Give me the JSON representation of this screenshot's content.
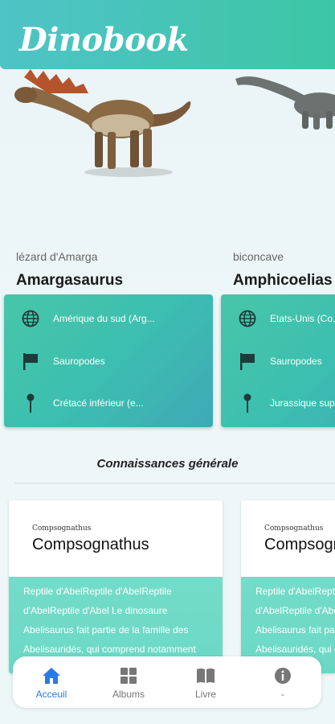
{
  "app": {
    "title": "Dinobook"
  },
  "dinosaurs": [
    {
      "subtitle": "lézard d'Amarga",
      "name": "Amargasaurus",
      "location": "Amérique du sud (Arg...",
      "group": "Sauropodes",
      "period": "Crétacé inférieur (e..."
    },
    {
      "subtitle": "biconcave",
      "name": "Amphicoelias",
      "location": "Etats-Unis (Co...",
      "group": "Sauropodes",
      "period": "Jurassique sup..."
    }
  ],
  "section": {
    "title": "Connaissances générale"
  },
  "knowledge_cards": [
    {
      "small_title": "Compsognathus",
      "title": "Compsognathus",
      "lines": [
        "Reptile d'AbelReptile d'AbelReptile",
        "d'AbelReptile d'Abel Le dinosaure",
        "Abelisaurus fait partie de la famille des",
        "Abelisauridés, qui comprend notamment des"
      ]
    },
    {
      "small_title": "Compsognathus",
      "title": "Compsognathus",
      "lines": [
        "Reptile d'AbelReptile d'AbelReptile",
        "d'AbelReptile d'Abel Le dinosaure",
        "Abelisaurus fait partie de la famille des",
        "Abelisauridés, qui comprend notamment des"
      ]
    }
  ],
  "nav": {
    "items": [
      {
        "label": "Acceuil",
        "icon": "home-icon",
        "active": true
      },
      {
        "label": "Albums",
        "icon": "grid-icon",
        "active": false
      },
      {
        "label": "Livre",
        "icon": "book-icon",
        "active": false
      },
      {
        "label": "-",
        "icon": "info-icon",
        "active": false
      }
    ]
  },
  "colors": {
    "accent": "#3dc6a5",
    "header": "#4fc3c7",
    "active": "#2a7ae2"
  }
}
